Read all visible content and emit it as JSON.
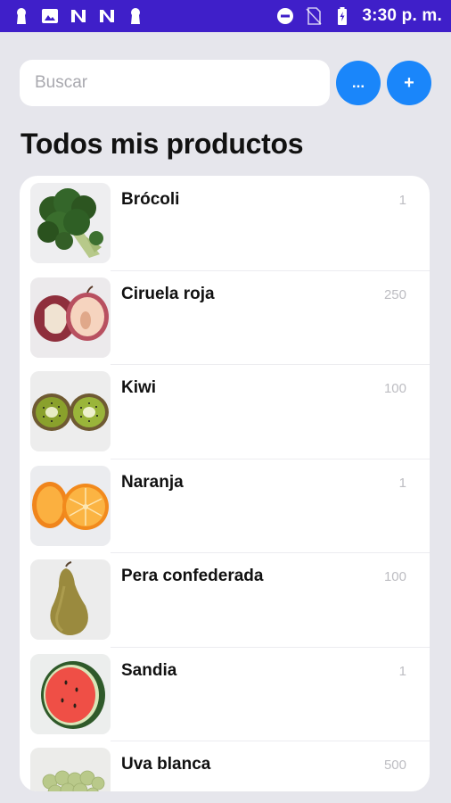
{
  "status_bar": {
    "time": "3:30 p. m.",
    "left_icons": [
      "keyhole-icon",
      "image-icon",
      "n-icon",
      "n-icon",
      "keyhole-icon"
    ],
    "right_icons": [
      "do-not-disturb-icon",
      "no-sim-icon",
      "battery-charging-icon"
    ],
    "background": "#3f1fc9"
  },
  "search": {
    "placeholder": "Buscar",
    "value": ""
  },
  "buttons": {
    "more_label": "...",
    "add_label": "+",
    "accent": "#1a86fa"
  },
  "title": "Todos mis productos",
  "products": [
    {
      "name": "Brócoli",
      "qty": "1",
      "image": "broccoli-image"
    },
    {
      "name": "Ciruela roja",
      "qty": "250",
      "image": "plum-image"
    },
    {
      "name": "Kiwi",
      "qty": "100",
      "image": "kiwi-image"
    },
    {
      "name": "Naranja",
      "qty": "1",
      "image": "orange-image"
    },
    {
      "name": "Pera confederada",
      "qty": "100",
      "image": "pear-image"
    },
    {
      "name": "Sandia",
      "qty": "1",
      "image": "watermelon-image"
    },
    {
      "name": "Uva blanca",
      "qty": "500",
      "image": "grapes-image"
    }
  ]
}
